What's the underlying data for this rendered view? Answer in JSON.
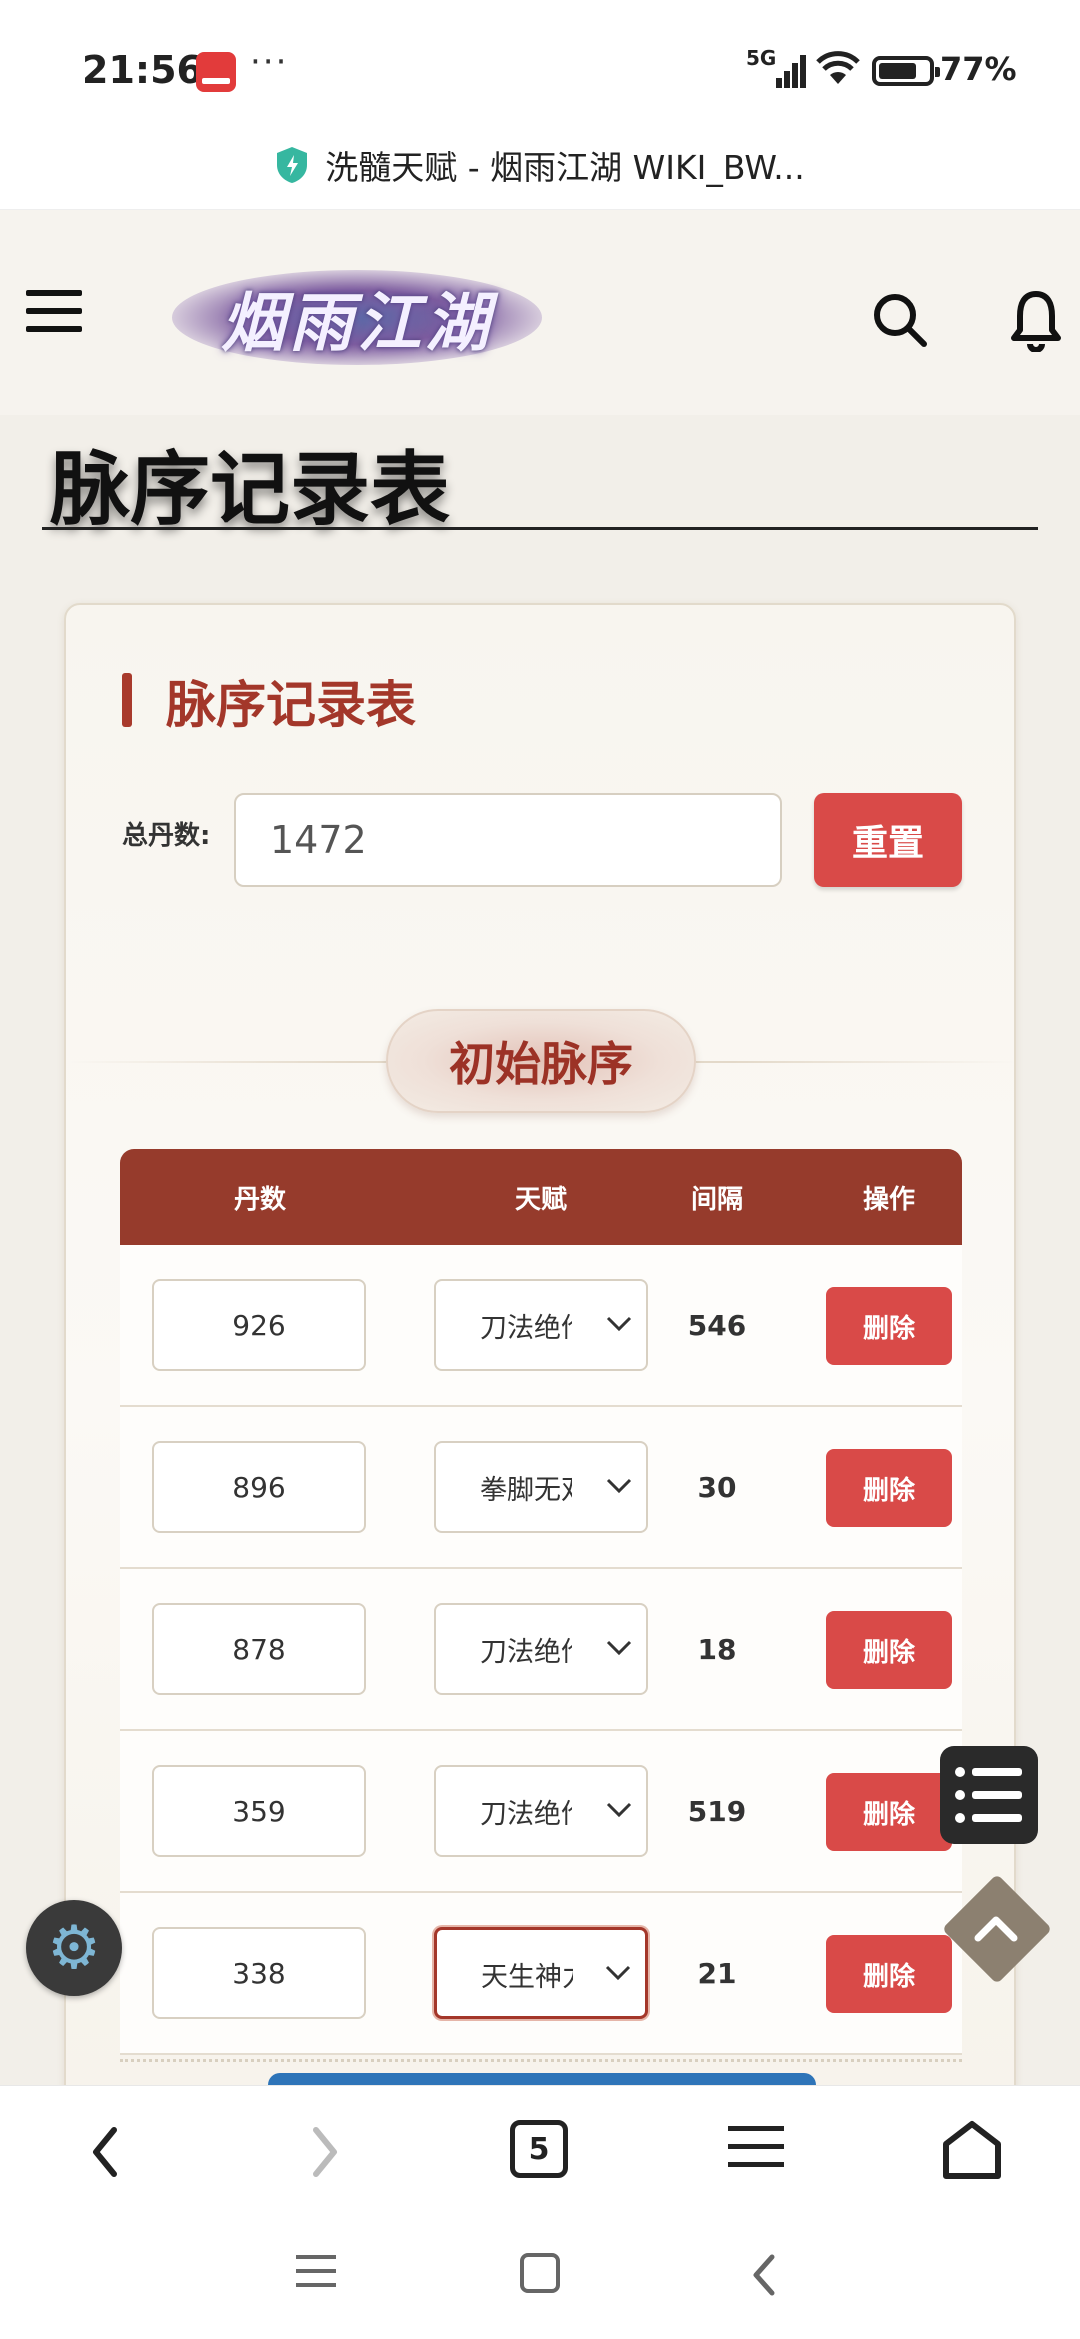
{
  "status_bar": {
    "time": "21:56",
    "more": "···",
    "network": "5G",
    "battery_percent": "77%",
    "battery_level": 0.77
  },
  "url_bar": {
    "title": "洗髓天赋 - 烟雨江湖 WIKI_BW..."
  },
  "site": {
    "logo_text": "烟雨江湖"
  },
  "page": {
    "title": "脉序记录表"
  },
  "card": {
    "title": "脉序记录表",
    "total_label": "总丹数:",
    "total_value": "1472",
    "reset_label": "重置",
    "section_label": "初始脉序"
  },
  "table": {
    "headers": [
      "丹数",
      "天赋",
      "间隔",
      "操作"
    ],
    "rows": [
      {
        "count": "926",
        "talent": "刀法绝伦",
        "gap": "546",
        "action": "删除"
      },
      {
        "count": "896",
        "talent": "拳脚无双",
        "gap": "30",
        "action": "删除"
      },
      {
        "count": "878",
        "talent": "刀法绝伦",
        "gap": "18",
        "action": "删除"
      },
      {
        "count": "359",
        "talent": "刀法绝伦",
        "gap": "519",
        "action": "删除"
      },
      {
        "count": "338",
        "talent": "天生神力",
        "gap": "21",
        "action": "删除"
      }
    ]
  },
  "browser_bar": {
    "tab_count": "5"
  },
  "icons": {
    "menu": "hamburger-icon",
    "search": "search-icon",
    "bell": "bell-icon",
    "settings": "gear-icon",
    "toc": "list-icon",
    "scroll_top": "chevron-up-icon",
    "back": "chevron-left-icon",
    "forward": "chevron-right-icon",
    "home": "home-icon"
  },
  "colors": {
    "accent": "#a3372a",
    "table_header": "#963b2c",
    "danger": "#d94a48",
    "primary": "#2e74b8"
  }
}
